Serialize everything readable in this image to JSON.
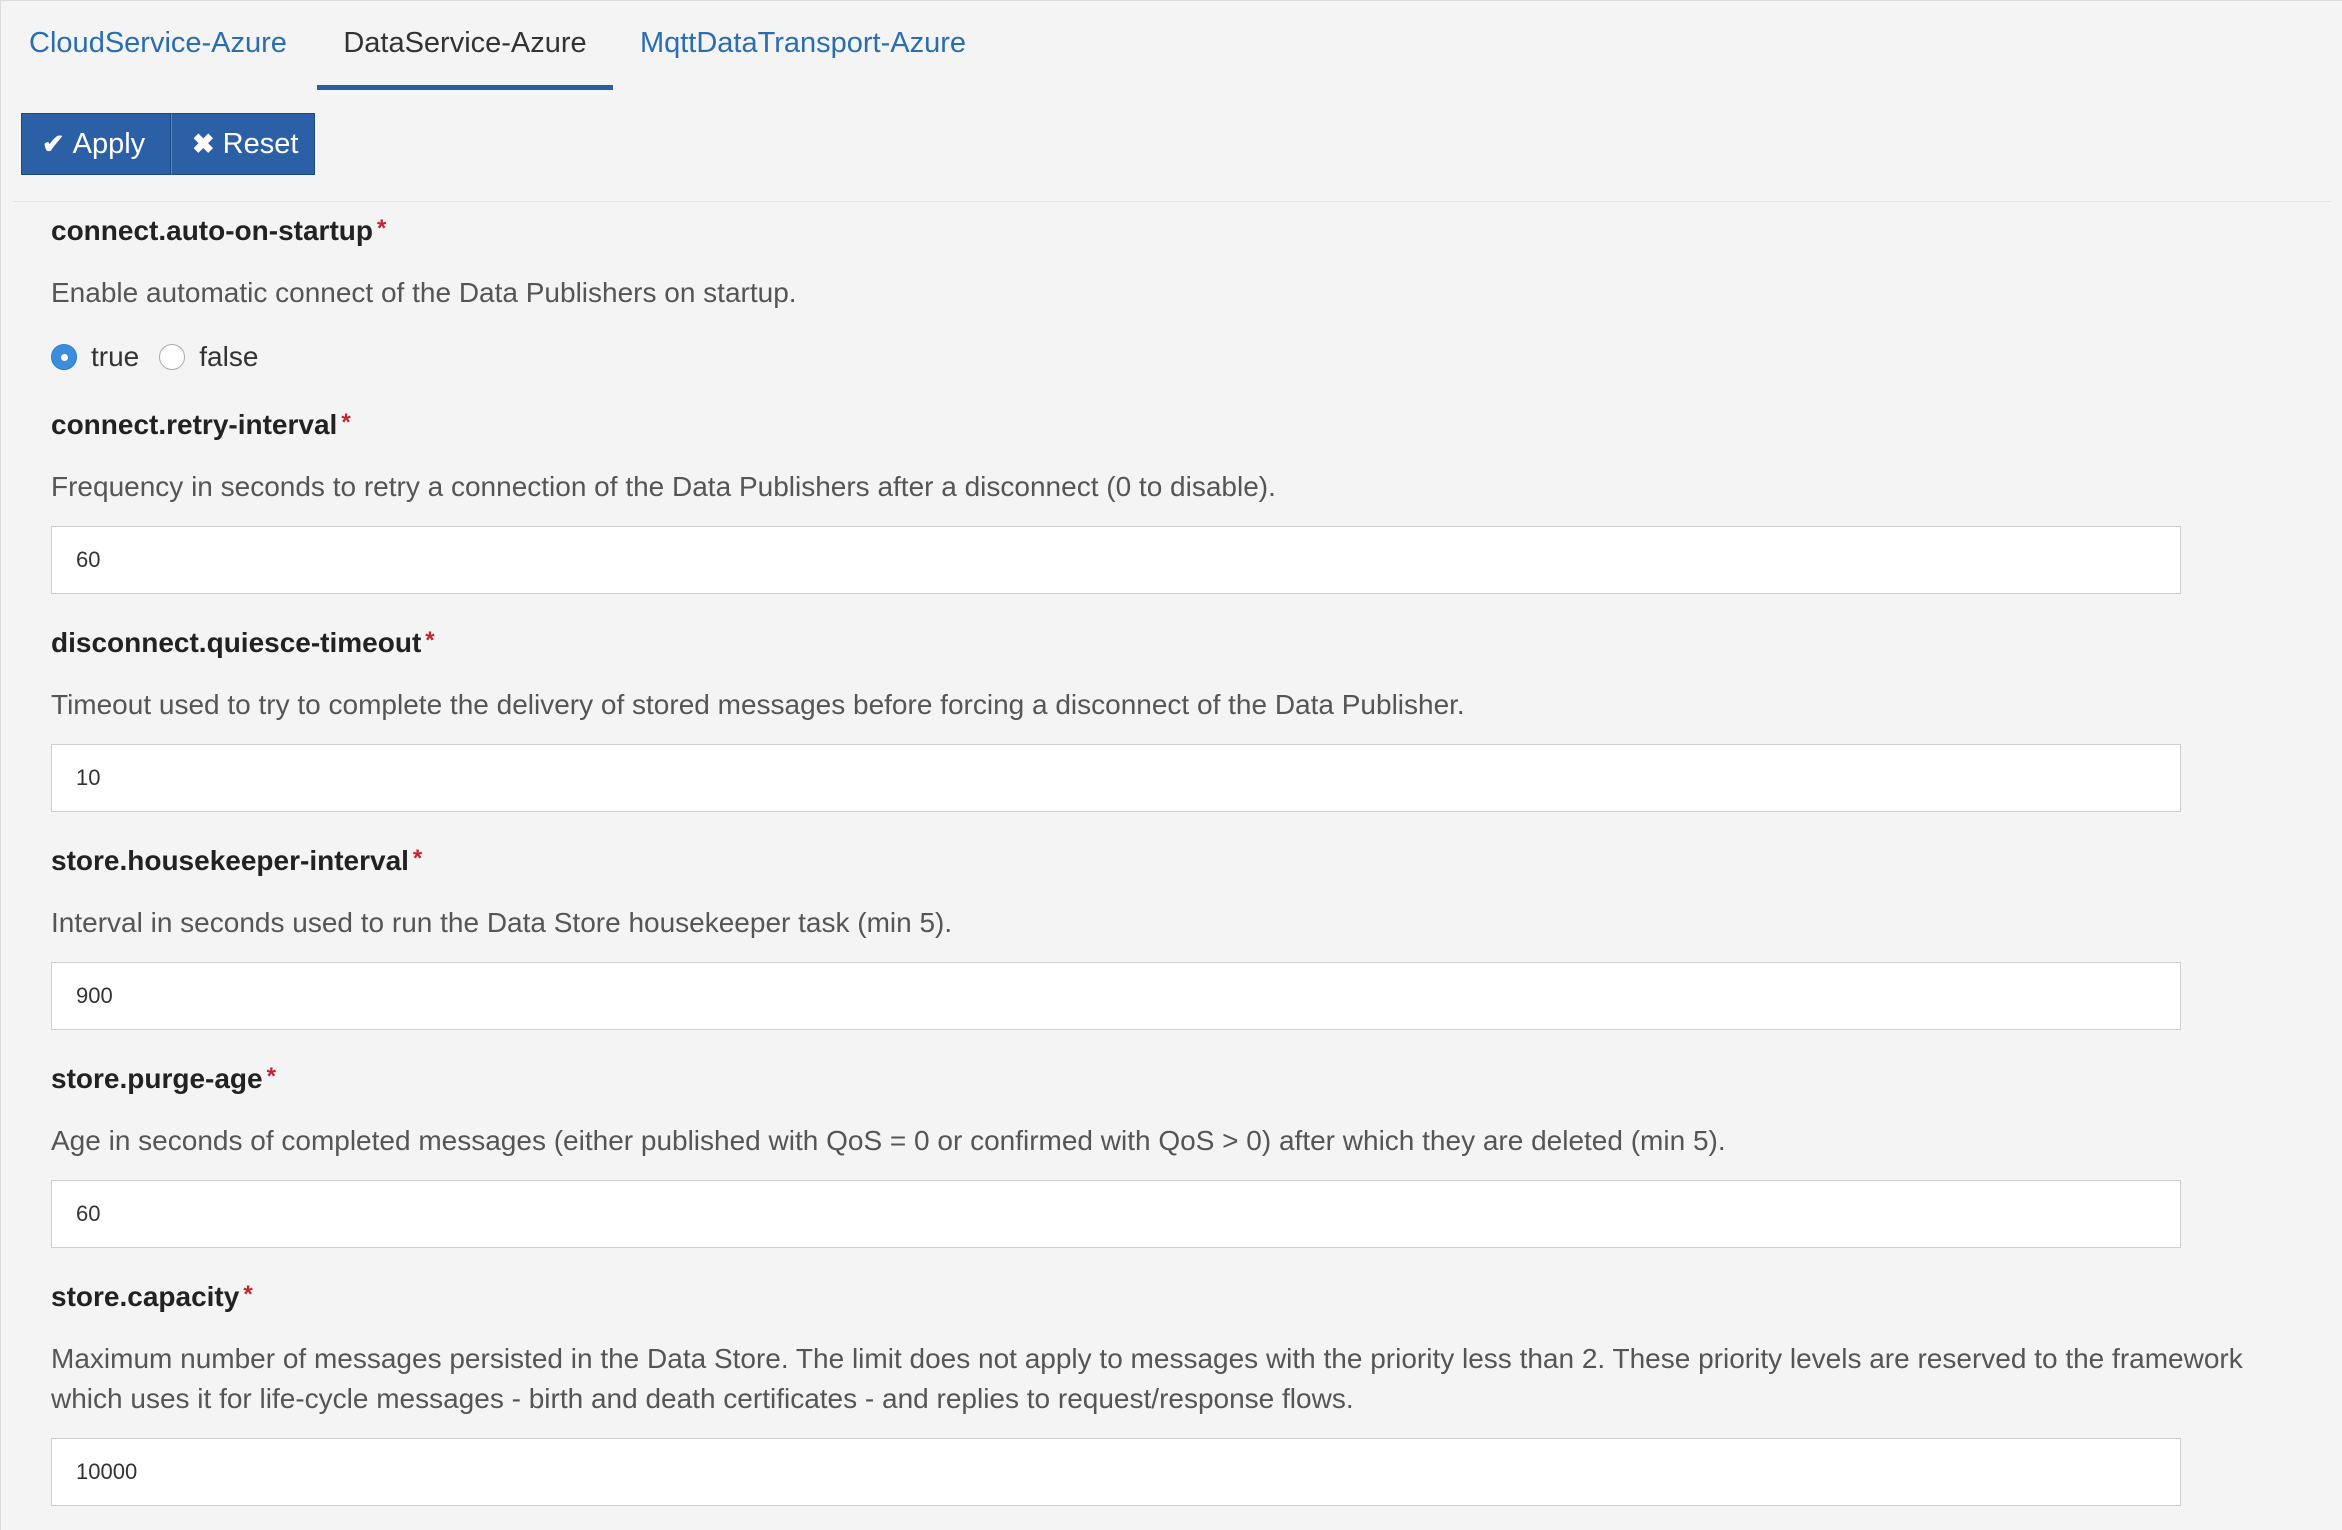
{
  "tabs": [
    {
      "label": "CloudService-Azure",
      "active": false
    },
    {
      "label": "DataService-Azure",
      "active": true
    },
    {
      "label": "MqttDataTransport-Azure",
      "active": false
    }
  ],
  "toolbar": {
    "apply_label": "Apply",
    "reset_label": "Reset"
  },
  "colors": {
    "accent": "#2b5fa6",
    "link": "#2a6db0",
    "required": "#c0262c",
    "radio_checked": "#3c8ce0"
  },
  "icons": {
    "apply": "check-icon",
    "reset": "times-icon"
  },
  "fields": [
    {
      "label": "connect.auto-on-startup",
      "required": "*",
      "description": "Enable automatic connect of the Data Publishers on startup.",
      "type": "radio",
      "options": [
        "true",
        "false"
      ],
      "selected": "true"
    },
    {
      "label": "connect.retry-interval",
      "required": "*",
      "description": "Frequency in seconds to retry a connection of the Data Publishers after a disconnect (0 to disable).",
      "value": "60"
    },
    {
      "label": "disconnect.quiesce-timeout",
      "required": "*",
      "description": "Timeout used to try to complete the delivery of stored messages before forcing a disconnect of the Data Publisher.",
      "value": "10"
    },
    {
      "label": "store.housekeeper-interval",
      "required": "*",
      "description": "Interval in seconds used to run the Data Store housekeeper task (min 5).",
      "value": "900"
    },
    {
      "label": "store.purge-age",
      "required": "*",
      "description": "Age in seconds of completed messages (either published with QoS = 0 or confirmed with QoS > 0) after which they are deleted (min 5).",
      "value": "60"
    },
    {
      "label": "store.capacity",
      "required": "*",
      "description": "Maximum number of messages persisted in the Data Store. The limit does not apply to messages with the priority less than 2. These priority levels are reserved to the framework which uses it for life-cycle messages - birth and death certificates - and replies to request/response flows.",
      "value": "10000"
    }
  ]
}
